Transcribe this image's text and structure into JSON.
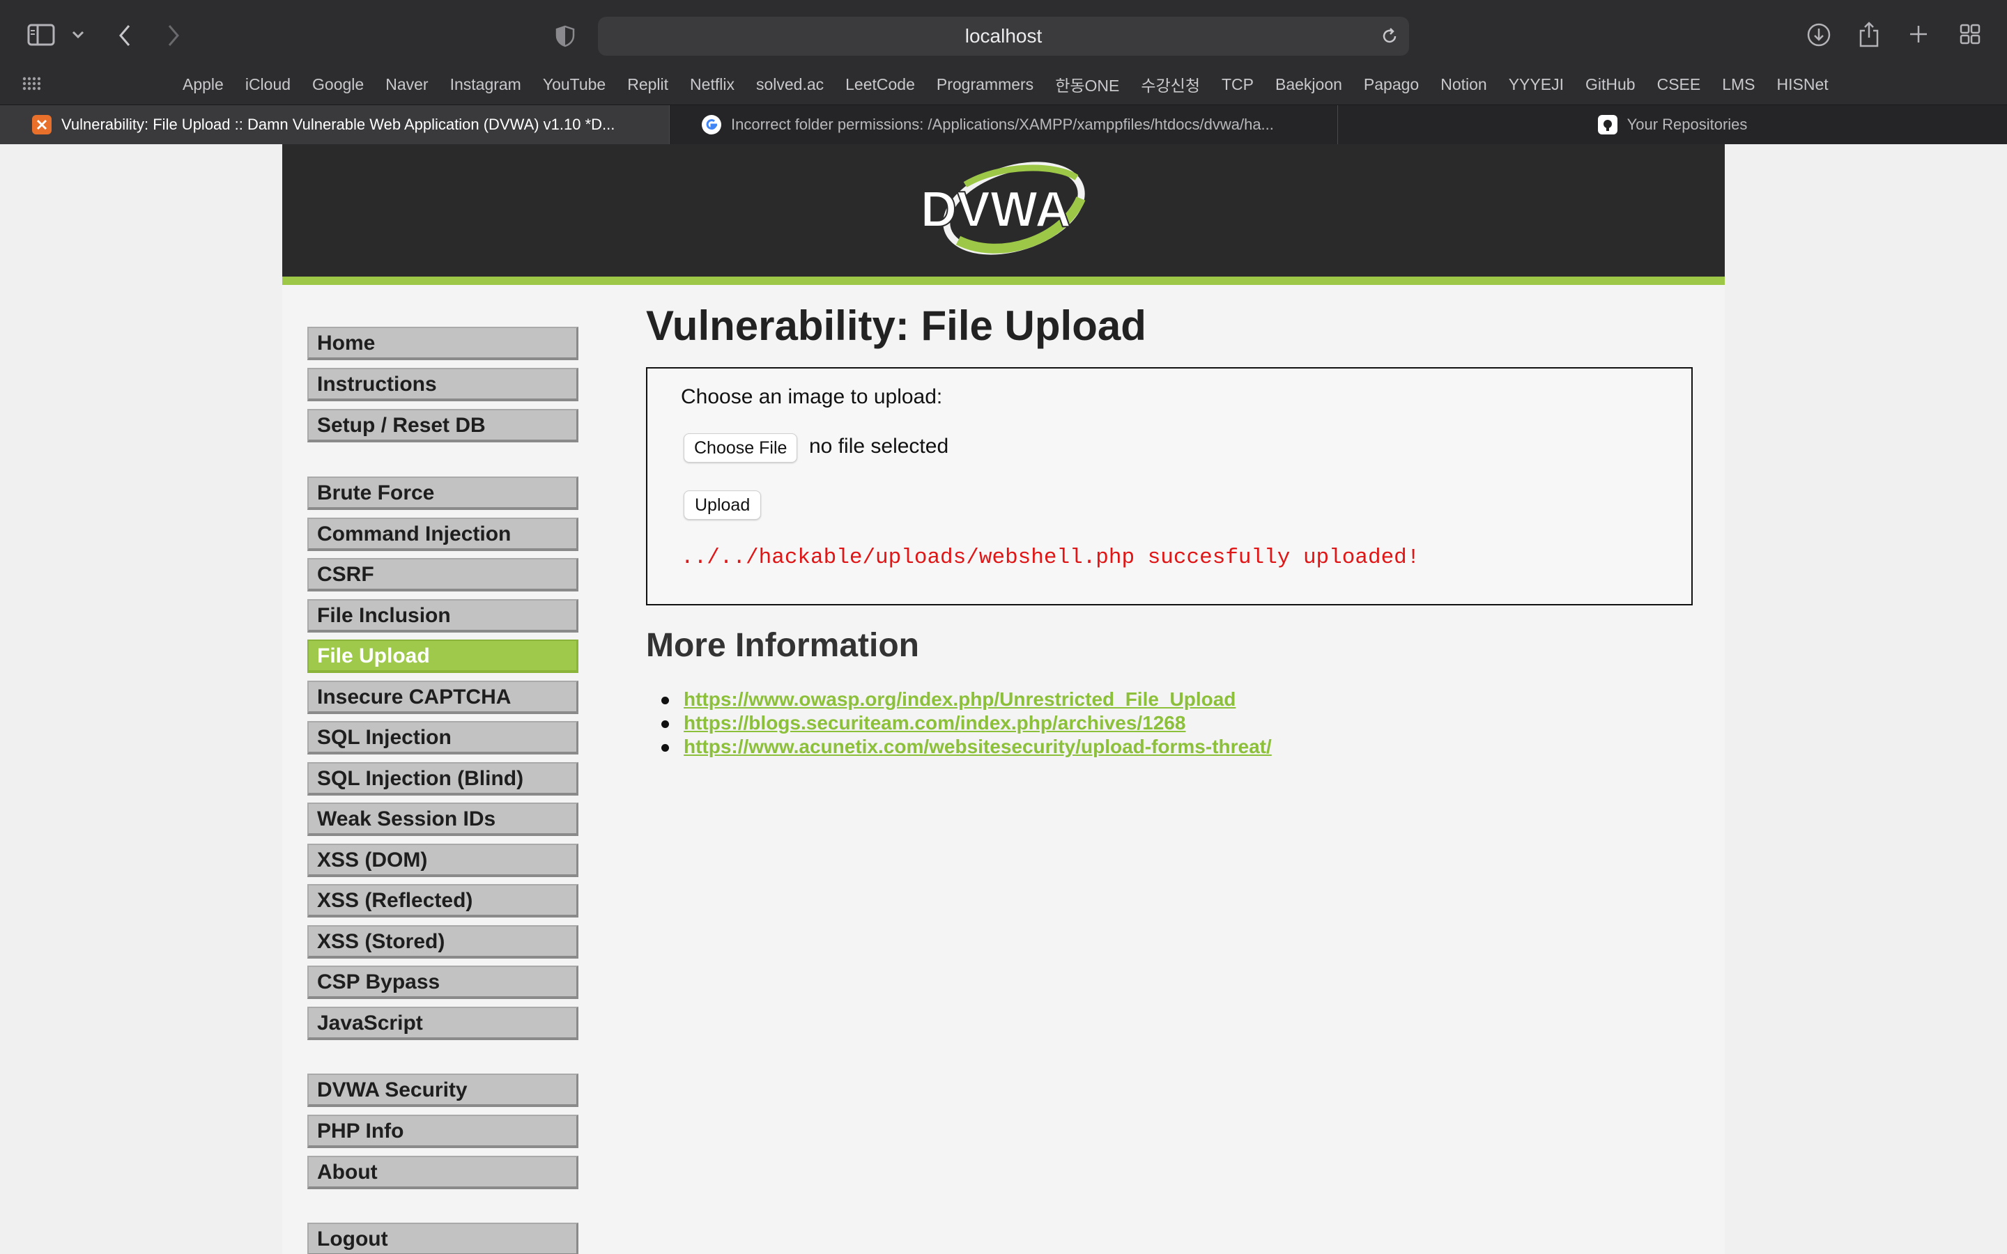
{
  "browser": {
    "address": "localhost",
    "bookmarks": [
      "Apple",
      "iCloud",
      "Google",
      "Naver",
      "Instagram",
      "YouTube",
      "Replit",
      "Netflix",
      "solved.ac",
      "LeetCode",
      "Programmers",
      "한동ONE",
      "수강신청",
      "TCP",
      "Baekjoon",
      "Papago",
      "Notion",
      "YYYEJI",
      "GitHub",
      "CSEE",
      "LMS",
      "HISNet"
    ],
    "tabs": [
      {
        "title": "Vulnerability: File Upload :: Damn Vulnerable Web Application (DVWA) v1.10 *D...",
        "active": true
      },
      {
        "title": "Incorrect folder permissions: /Applications/XAMPP/xamppfiles/htdocs/dvwa/ha...",
        "active": false
      },
      {
        "title": "Your Repositories",
        "active": false
      }
    ]
  },
  "site": {
    "logo_text": "DVWA",
    "accent_color": "#9dc847",
    "menu_groups": [
      [
        "Home",
        "Instructions",
        "Setup / Reset DB"
      ],
      [
        "Brute Force",
        "Command Injection",
        "CSRF",
        "File Inclusion",
        "File Upload",
        "Insecure CAPTCHA",
        "SQL Injection",
        "SQL Injection (Blind)",
        "Weak Session IDs",
        "XSS (DOM)",
        "XSS (Reflected)",
        "XSS (Stored)",
        "CSP Bypass",
        "JavaScript"
      ],
      [
        "DVWA Security",
        "PHP Info",
        "About"
      ],
      [
        "Logout"
      ]
    ],
    "selected_menu": "File Upload"
  },
  "main": {
    "title": "Vulnerability: File Upload",
    "upload": {
      "prompt": "Choose an image to upload:",
      "choose_file_label": "Choose File",
      "file_status": "no file selected",
      "upload_label": "Upload",
      "result_message": "../../hackable/uploads/webshell.php succesfully uploaded!"
    },
    "more_info_title": "More Information",
    "links": [
      "https://www.owasp.org/index.php/Unrestricted_File_Upload",
      "https://blogs.securiteam.com/index.php/archives/1268",
      "https://www.acunetix.com/websitesecurity/upload-forms-threat/"
    ]
  }
}
